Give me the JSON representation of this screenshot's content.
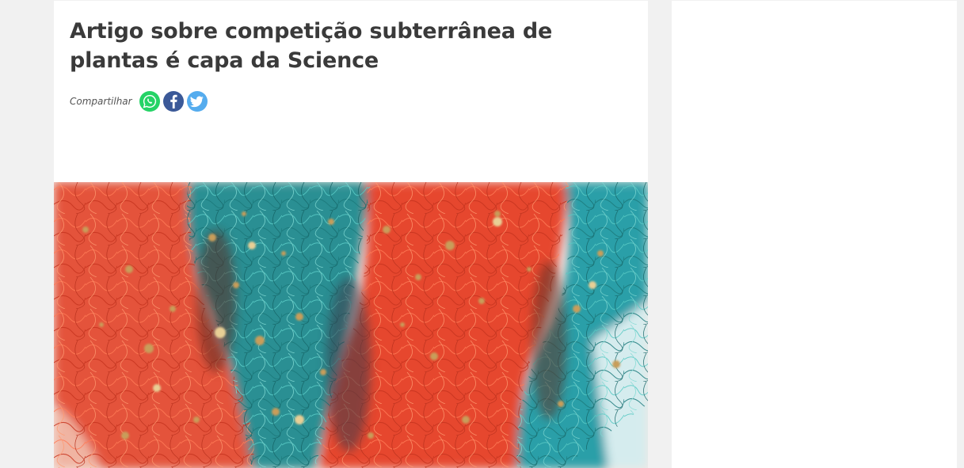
{
  "article": {
    "title": "Artigo sobre competição subterrânea de plantas é capa da Science",
    "share": {
      "label": "Compartilhar",
      "buttons": [
        {
          "name": "whatsapp",
          "icon": "whatsapp-icon",
          "color": "#25d366"
        },
        {
          "name": "facebook",
          "icon": "facebook-icon",
          "color": "#3b5998"
        },
        {
          "name": "twitter",
          "icon": "twitter-icon",
          "color": "#55acee"
        }
      ]
    },
    "hero_image": {
      "subject": "tangled plant roots, alternating red-orange and teal colored clusters"
    }
  },
  "colors": {
    "page_background": "#f1f1f1",
    "card_background": "#ffffff",
    "title_text": "#3a3a3a",
    "root_red": "#e0452d",
    "root_teal": "#2a9a9a"
  }
}
